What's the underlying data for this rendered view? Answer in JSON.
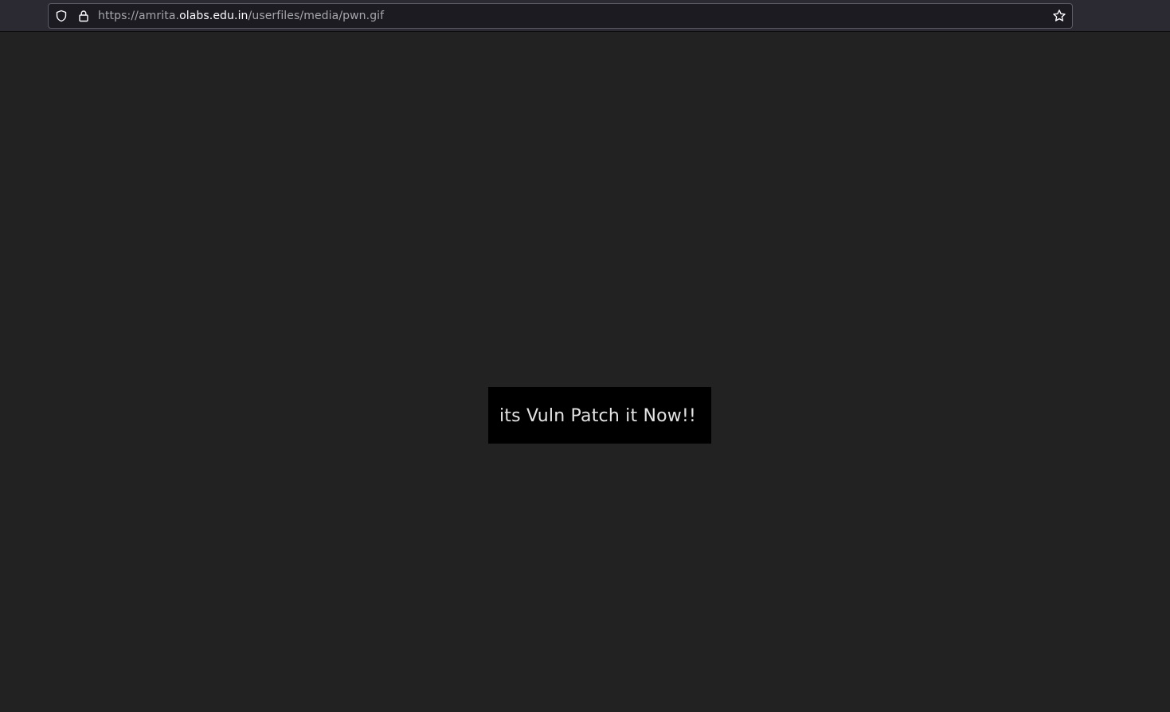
{
  "browser": {
    "url": {
      "prefix": "https://amrita.",
      "host": "olabs.edu.in",
      "path": "/userfiles/media/pwn.gif"
    },
    "icons": {
      "shield": "tracking-protection-shield-icon",
      "lock": "lock-icon",
      "bookmark": "bookmark-star-icon"
    }
  },
  "image": {
    "text": "its Vuln Patch it Now!!",
    "background": "#000000",
    "text_color": "#e3e3e3"
  },
  "colors": {
    "page_background": "#222222",
    "toolbar": "#2b2a33",
    "urlbar": "#1c1b22"
  }
}
